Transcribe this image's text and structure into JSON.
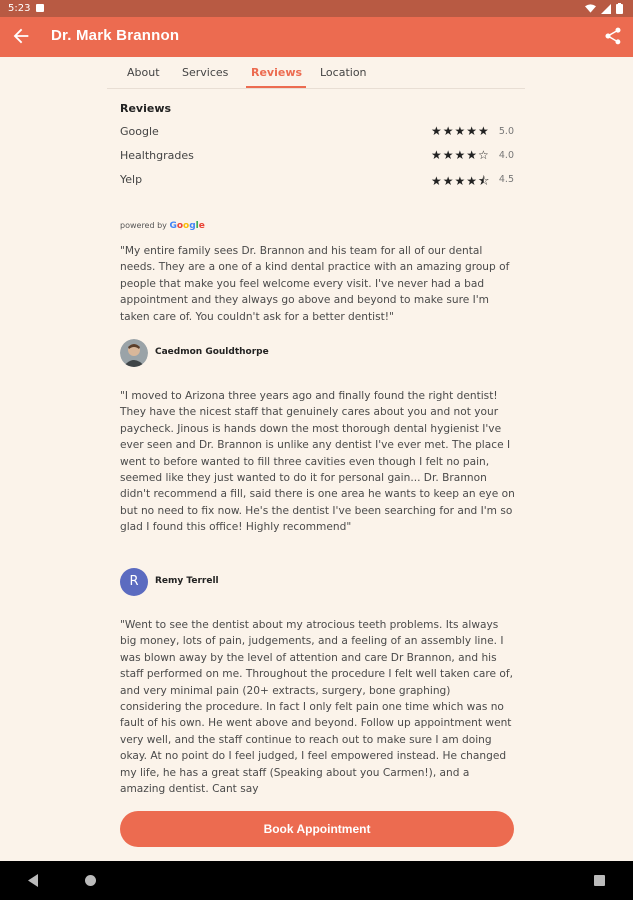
{
  "status_bar": {
    "time": "5:23"
  },
  "app_bar": {
    "title": "Dr. Mark Brannon"
  },
  "tabs": [
    {
      "label": "About"
    },
    {
      "label": "Services"
    },
    {
      "label": "Reviews"
    },
    {
      "label": "Location"
    }
  ],
  "reviews_section": {
    "title": "Reviews",
    "ratings": [
      {
        "source": "Google",
        "stars": "★★★★★",
        "score": "5.0"
      },
      {
        "source": "Healthgrades",
        "stars": "★★★★☆",
        "score": "4.0"
      },
      {
        "source": "Yelp",
        "stars": "★★★★⯪",
        "score": "4.5"
      }
    ],
    "powered_by": "powered by",
    "google_word": "Google"
  },
  "reviews": [
    {
      "text": "\"My entire family sees Dr. Brannon and his team for all of our dental needs. They are a one of a kind dental practice with an amazing group of people that make you feel welcome every visit. I've never had a bad appointment and they always go above and beyond to make sure I'm taken care of. You couldn't ask for a better dentist!\"",
      "author": "Caedmon Gouldthorpe"
    },
    {
      "text": "\"I moved to Arizona three years ago and finally found the right dentist! They have the nicest staff that genuinely cares about you and not your paycheck. Jinous is hands down the most thorough dental hygienist I've ever seen and Dr. Brannon is unlike any dentist I've ever met. The place I went to before wanted to fill three cavities even though I felt no pain, seemed like they just wanted to do it for personal gain... Dr. Brannon didn't recommend a fill, said there is one area he wants to keep an eye on but no need to fix now. He's the dentist I've been searching for and I'm so glad I found this office! Highly recommend\"",
      "author": "Remy Terrell",
      "avatar_letter": "R"
    },
    {
      "text": "\"Went to see the dentist about my atrocious teeth problems. Its always big money, lots of pain, judgements, and a feeling of an assembly line. I was blown away by the level of attention and care Dr Brannon, and his staff performed on me. Throughout the procedure I felt well taken care of, and very minimal pain (20+ extracts, surgery, bone graphing) considering the procedure. In fact I only felt pain one time which was no fault of his own. He went above and beyond. Follow up appointment went very well, and the staff continue to reach out to make sure I am doing okay. At no point do I feel judged, I feel empowered instead. He changed my life, he has a great staff (Speaking about you Carmen!), and a amazing dentist. Cant say"
    }
  ],
  "book_button": {
    "label": "Book Appointment"
  },
  "colors": {
    "primary": "#ec6b50",
    "status_bar": "#b85a43",
    "background": "#fbf3ea",
    "avatar_r": "#5b6bc0"
  }
}
